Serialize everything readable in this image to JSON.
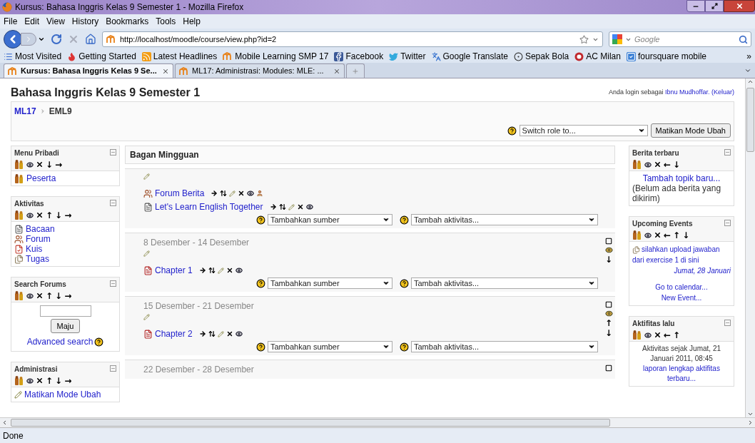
{
  "window": {
    "title": "Kursus: Bahasa Inggris Kelas 9 Semester 1 - Mozilla Firefox"
  },
  "menu": [
    "File",
    "Edit",
    "View",
    "History",
    "Bookmarks",
    "Tools",
    "Help"
  ],
  "address": {
    "value": "http://localhost/moodle/course/view.php?id=2"
  },
  "search": {
    "placeholder": "Google"
  },
  "bookmarks": [
    {
      "label": "Most Visited",
      "kind": "list"
    },
    {
      "label": "Getting Started",
      "kind": "flame"
    },
    {
      "label": "Latest Headlines",
      "kind": "rss"
    },
    {
      "label": "Mobile Learning SMP 17",
      "kind": "moodle"
    },
    {
      "label": "Facebook",
      "kind": "facebook"
    },
    {
      "label": "Twitter",
      "kind": "bird"
    },
    {
      "label": "Google Translate",
      "kind": "translate"
    },
    {
      "label": "Sepak Bola",
      "kind": "ball"
    },
    {
      "label": "AC Milan",
      "kind": "badge"
    },
    {
      "label": "foursquare mobile",
      "kind": "check"
    }
  ],
  "bookmarks_more": "»",
  "tabs": [
    {
      "label": "Kursus: Bahasa Inggris Kelas 9 Se...",
      "selected": true
    },
    {
      "label": "ML17: Administrasi: Modules: MLE: ...",
      "selected": false
    }
  ],
  "page": {
    "title": "Bahasa Inggris Kelas 9 Semester 1",
    "login": {
      "prefix": "Anda login sebagai",
      "user": "Ibnu Mudhoffar.",
      "logout": "(Keluar)"
    },
    "breadcrumb": [
      "ML17",
      "EML9"
    ],
    "switch_role": {
      "value": "Switch role to..."
    },
    "edit_button": "Matikan Mode Ubah"
  },
  "left_blocks": [
    {
      "title": "Menu Pribadi",
      "kind": "links",
      "moves": [
        "↓",
        "→"
      ],
      "items": [
        {
          "label": "Peserta",
          "kind": "people"
        }
      ]
    },
    {
      "title": "Aktivitas",
      "kind": "links",
      "moves": [
        "↑",
        "↓",
        "→"
      ],
      "items": [
        {
          "label": "Bacaan",
          "kind": "page"
        },
        {
          "label": "Forum",
          "kind": "forum"
        },
        {
          "label": "Kuis",
          "kind": "quiz"
        },
        {
          "label": "Tugas",
          "kind": "assignment"
        }
      ]
    },
    {
      "title": "Search Forums",
      "kind": "search",
      "moves": [
        "↑",
        "↓",
        "→"
      ],
      "button": "Maju",
      "link": "Advanced search"
    },
    {
      "title": "Administrasi",
      "kind": "links",
      "moves": [
        "↑",
        "↓",
        "→"
      ],
      "items": [
        {
          "label": "Matikan Mode Ubah",
          "kind": "edit"
        }
      ]
    }
  ],
  "main": {
    "title": "Bagan Mingguan",
    "sections": [
      {
        "activities": [
          {
            "label": "Forum Berita",
            "kind": "forum",
            "group_mode": true
          },
          {
            "label": "Let's Learn English Together",
            "kind": "page",
            "group_mode": false
          }
        ],
        "resource_select": "Tambahkan sumber",
        "activity_select": "Tambah aktivitas..."
      },
      {
        "dates": "8 Desember - 14 Desember",
        "moves": [
          "↓"
        ],
        "activities": [
          {
            "label": "Chapter 1",
            "kind": "pdf",
            "group_mode": false
          }
        ],
        "resource_select": "Tambahkan sumber",
        "activity_select": "Tambah aktivitas..."
      },
      {
        "dates": "15 Desember - 21 Desember",
        "moves": [
          "↑",
          "↓"
        ],
        "activities": [
          {
            "label": "Chapter 2",
            "kind": "pdf",
            "group_mode": false
          }
        ],
        "resource_select": "Tambahkan sumber",
        "activity_select": "Tambah aktivitas..."
      },
      {
        "dates": "22 Desember - 28 Desember"
      }
    ]
  },
  "right_blocks": [
    {
      "title": "Berita terbaru",
      "kind": "news",
      "moves": [
        "←",
        "↓"
      ],
      "link": "Tambah topik baru...",
      "text": "(Belum ada berita yang dikirim)"
    },
    {
      "title": "Upcoming Events",
      "kind": "events",
      "moves": [
        "←",
        "↑",
        "↓"
      ],
      "event": "silahkan upload jawaban dari exercise 1 di sini",
      "date": "Jumat, 28 Januari",
      "links": [
        "Go to calendar...",
        "New Event..."
      ]
    },
    {
      "title": "Aktifitas lalu",
      "kind": "recent",
      "moves": [
        "←",
        "↑"
      ],
      "text": "Aktivitas sejak Jumat, 21 Januari 2011, 08:45",
      "link": "laporan lengkap aktifitas terbaru..."
    }
  ],
  "status": "Done"
}
